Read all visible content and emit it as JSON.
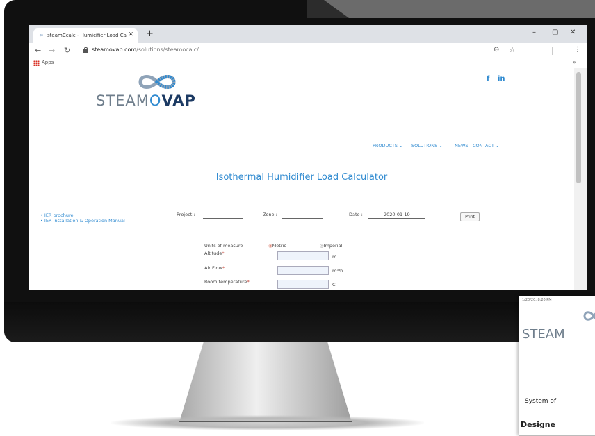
{
  "browser": {
    "tab_title": "steamCcalc - Humicifier Load Ca",
    "tab_close": "✕",
    "new_tab": "+",
    "window_controls": [
      "–",
      "▢",
      "✕"
    ],
    "nav_icons": [
      "back-arrow-icon",
      "forward-arrow-icon",
      "reload-icon"
    ],
    "url_host": "steamovap.com",
    "url_path": "/solutions/steamocalc/",
    "bookmarks_label": "Apps",
    "more_bookmarks": "»"
  },
  "site": {
    "logo_light": "STEAM",
    "logo_bold": "VAP",
    "logo_o": "O",
    "social": [
      "f",
      "in"
    ],
    "nav": [
      "PRODUCTS ⌄",
      "SOLUTIONS ⌄",
      "NEWS",
      "CONTACT ⌄"
    ],
    "heading": "Isothermal Humidifier Load Calculator",
    "links": [
      "IER brochure",
      "IER Installation & Operation Manual"
    ],
    "project_label": "Project :",
    "zone_label": "Zone :",
    "date_label": "Date :",
    "date_value": "2020-01-19",
    "print_label": "Print",
    "units_label": "Units of measure",
    "metric_label": "Metric",
    "imperial_label": "Imperial",
    "fields": [
      {
        "label": "Altitude",
        "unit": "m"
      },
      {
        "label": "Air Flow",
        "unit": "m³/h"
      },
      {
        "label": "Room temperature",
        "unit": "C"
      }
    ],
    "required_mark": "*"
  },
  "overlay": {
    "timestamp": "1/20/20, 8:20 PM",
    "logo": "STEAM",
    "system_text": "System of",
    "designed_text": "Designe"
  },
  "colors": {
    "accent": "#2f8ad0",
    "brand_dark": "#1c3a63",
    "brand_gray": "#6f7e8c"
  }
}
